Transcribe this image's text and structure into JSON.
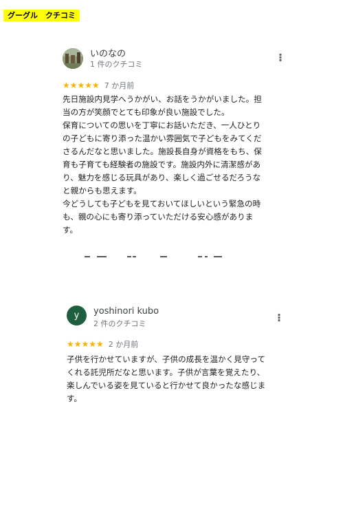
{
  "tag": {
    "label": "グーグル　クチコミ"
  },
  "reviews": [
    {
      "author": "いのなの",
      "review_count": "1 件のクチコミ",
      "stars": "★★★★★",
      "rating": 5,
      "date": "7 か月前",
      "lines": [
        "先日施設内見学へうかがい、お話をうかがいました。担",
        "当の方が笑顔でとても印象が良い施設でした。",
        "保育についての思いを丁寧にお話いただき、一人ひとり",
        "の子どもに寄り添った温かい雰囲気で子どもをみてくだ",
        "さるんだなと思いました。施設長自身が資格をもち、保",
        "育も子育ても経験者の施設です。施設内外に清潔感があ",
        "り、魅力を感じる玩具があり、楽しく過ごせるだろうな",
        "と親からも思えます。",
        "今どうしても子どもを見ておいてほしいという緊急の時",
        "も、親の心にも寄り添っていただける安心感がありま",
        "す。"
      ]
    },
    {
      "author": "yoshinori kubo",
      "avatar_letter": "y",
      "review_count": "2 件のクチコミ",
      "stars": "★★★★★",
      "rating": 5,
      "date": "2 か月前",
      "lines": [
        "子供を行かせていますが、子供の成長を温かく見守って",
        "くれる託児所だなと思います。子供が言葉を覚えたり、",
        "楽しんでいる姿を見ていると行かせて良かったな感じま",
        "す。"
      ]
    }
  ],
  "colors": {
    "tag_bg": "#ffff00",
    "star": "#f6b400",
    "avatar_bg": "#1e5f3f"
  }
}
